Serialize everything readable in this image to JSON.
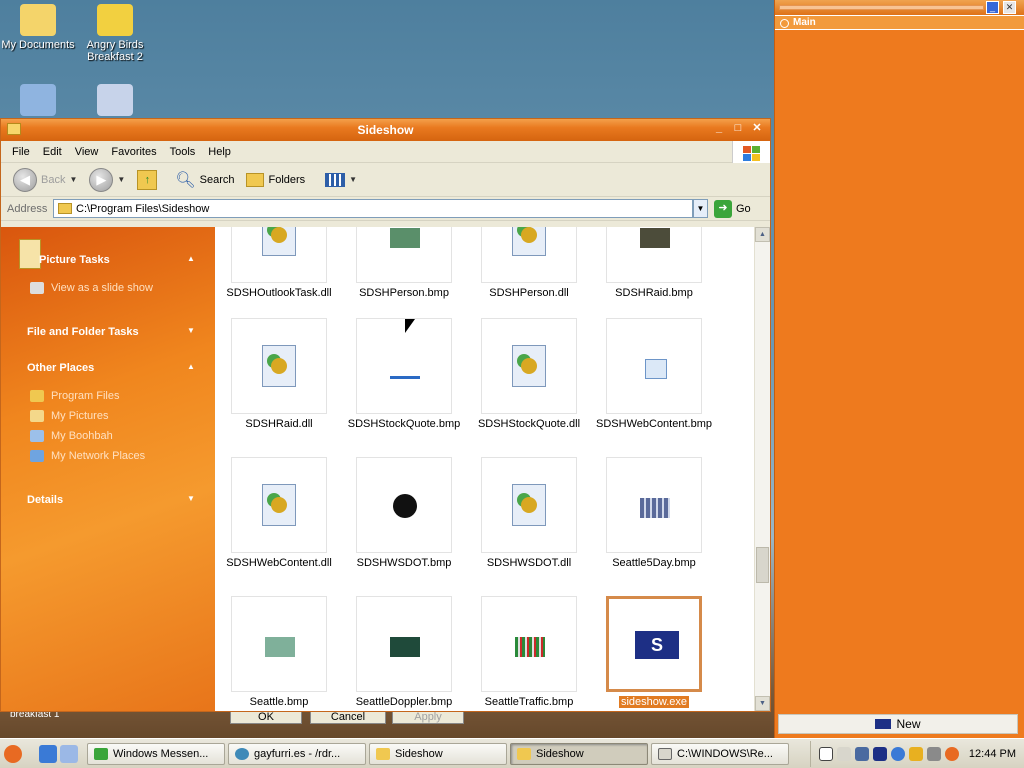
{
  "desktop": {
    "icons": [
      {
        "label": "My Documents"
      },
      {
        "label": "Angry Birds Breakfast 2"
      },
      {
        "label": ""
      },
      {
        "label": ""
      }
    ],
    "partial_label": "breakfast 1"
  },
  "window": {
    "title": "Sideshow",
    "menu": [
      "File",
      "Edit",
      "View",
      "Favorites",
      "Tools",
      "Help"
    ],
    "toolbar": {
      "back": "Back",
      "search": "Search",
      "folders": "Folders"
    },
    "address": {
      "label": "Address",
      "value": "C:\\Program Files\\Sideshow",
      "go": "Go"
    }
  },
  "taskpane": {
    "picture_tasks": "Picture Tasks",
    "slide_show": "View as a slide show",
    "file_folder_tasks": "File and Folder Tasks",
    "other_places": "Other Places",
    "places": [
      "Program Files",
      "My Pictures",
      "My Boohbah",
      "My Network Places"
    ],
    "details": "Details"
  },
  "files": [
    {
      "name": "SDSHOutlookTask.dll",
      "kind": "dll"
    },
    {
      "name": "SDSHPerson.bmp",
      "kind": "bmp"
    },
    {
      "name": "SDSHPerson.dll",
      "kind": "dll"
    },
    {
      "name": "SDSHRaid.bmp",
      "kind": "bmp"
    },
    {
      "name": "SDSHRaid.dll",
      "kind": "dll"
    },
    {
      "name": "SDSHStockQuote.bmp",
      "kind": "bmp"
    },
    {
      "name": "SDSHStockQuote.dll",
      "kind": "dll"
    },
    {
      "name": "SDSHWebContent.bmp",
      "kind": "bmp"
    },
    {
      "name": "SDSHWebContent.dll",
      "kind": "dll"
    },
    {
      "name": "SDSHWSDOT.bmp",
      "kind": "bmp"
    },
    {
      "name": "SDSHWSDOT.dll",
      "kind": "dll"
    },
    {
      "name": "Seattle5Day.bmp",
      "kind": "bmp"
    },
    {
      "name": "Seattle.bmp",
      "kind": "bmp"
    },
    {
      "name": "SeattleDoppler.bmp",
      "kind": "bmp"
    },
    {
      "name": "SeattleTraffic.bmp",
      "kind": "bmp"
    },
    {
      "name": "sideshow.exe",
      "kind": "exe",
      "selected": true
    }
  ],
  "behind_dialog": {
    "ok": "OK",
    "cancel": "Cancel",
    "apply": "Apply"
  },
  "side_panel": {
    "main": "Main",
    "new": "New"
  },
  "taskbar": {
    "tasks": [
      {
        "label": "Windows Messen..."
      },
      {
        "label": "gayfurri.es - /rdr..."
      },
      {
        "label": "Sideshow"
      },
      {
        "label": "Sideshow",
        "active": true
      },
      {
        "label": "C:\\WINDOWS\\Re..."
      }
    ],
    "clock": "12:44 PM"
  }
}
